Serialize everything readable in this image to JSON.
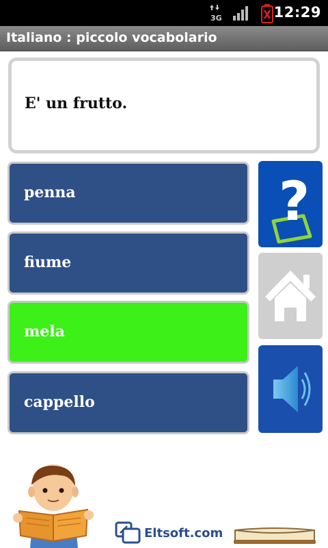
{
  "status": {
    "time": "12:29",
    "network": "3G"
  },
  "app": {
    "title": "Italiano : piccolo vocabolario"
  },
  "question": {
    "text": "E' un frutto."
  },
  "answers": [
    {
      "label": "penna",
      "correct": false
    },
    {
      "label": "fiume",
      "correct": false
    },
    {
      "label": "mela",
      "correct": true
    },
    {
      "label": "cappello",
      "correct": false
    }
  ],
  "side_buttons": [
    {
      "icon": "help-icon",
      "color": "#0a4fb6"
    },
    {
      "icon": "home-icon",
      "color": "#cfcfcf"
    },
    {
      "icon": "speaker-icon",
      "color": "#1a4fae"
    }
  ],
  "footer": {
    "brand": "Eltsoft.com"
  },
  "colors": {
    "answer": "#2f4f87",
    "answer_correct": "#3cf018"
  }
}
